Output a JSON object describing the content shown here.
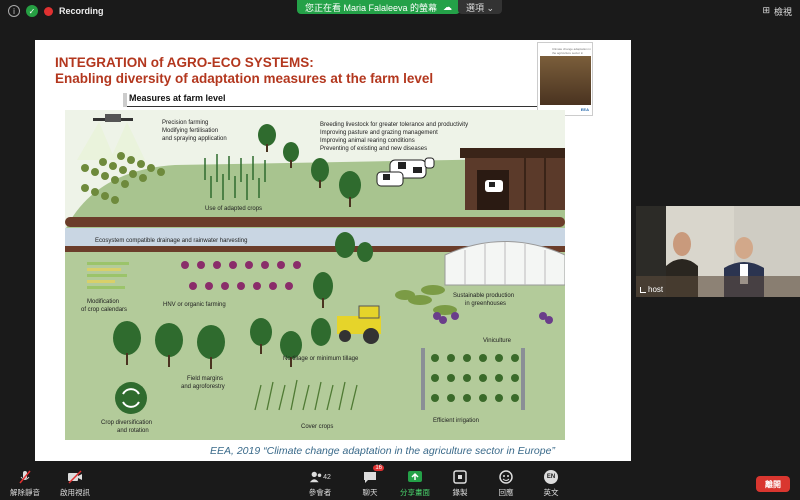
{
  "topbar": {
    "recording_label": "Recording",
    "share_notice": "您正在看 Maria Falaleeva 的螢幕",
    "options_label": "選項",
    "view_label": "檢視"
  },
  "slide": {
    "title_line1": "INTEGRATION of AGRO-ECO SYSTEMS:",
    "title_line2": "Enabling diversity of adaptation measures at the farm level",
    "section_header": "Measures at farm level",
    "citation": "EEA, 2019 “Climate change adaptation in the agriculture sector in Europe”",
    "thumbnail_text": "Climate change adaptation in the agriculture sector in Europe",
    "thumbnail_logo": "EEA",
    "labels": {
      "precision": [
        "Precision farming",
        "Modifying fertilisation",
        "and spraying application"
      ],
      "livestock": [
        "Breeding livestock for greater tolerance and productivity",
        "Improving pasture and grazing management",
        "Improving animal rearing conditions",
        "Preventing of existing and new diseases"
      ],
      "adapted_crops": "Use of adapted crops",
      "drainage": "Ecosystem compatible drainage and rainwater harvesting",
      "calendars": [
        "Modification",
        "of crop calendars"
      ],
      "hnv": "HNV or organic farming",
      "greenhouses": [
        "Sustainable production",
        "in greenhouses"
      ],
      "viniculture": "Viniculture",
      "tillage": "No tillage or minimum tillage",
      "margins": [
        "Field margins",
        "and agroforestry"
      ],
      "diversification": [
        "Crop diversification",
        "and rotation"
      ],
      "cover_crops": "Cover crops",
      "irrigation": "Efficient irrigation"
    }
  },
  "video": {
    "participant_label": "host"
  },
  "toolbar": {
    "unmute": "解除靜音",
    "start_video": "啟用視訊",
    "participants": "參會者",
    "participants_count": "42",
    "chat": "聊天",
    "chat_badge": "16",
    "share_screen": "分享畫面",
    "record": "錄製",
    "reactions": "回應",
    "language": "英文",
    "language_icon": "EN",
    "end": "離開"
  },
  "colors": {
    "title": "#b3371e",
    "share_green": "#24a148",
    "end_red": "#d9362f",
    "field_green": "#a8c48f",
    "tree_green": "#2f6b2e"
  }
}
